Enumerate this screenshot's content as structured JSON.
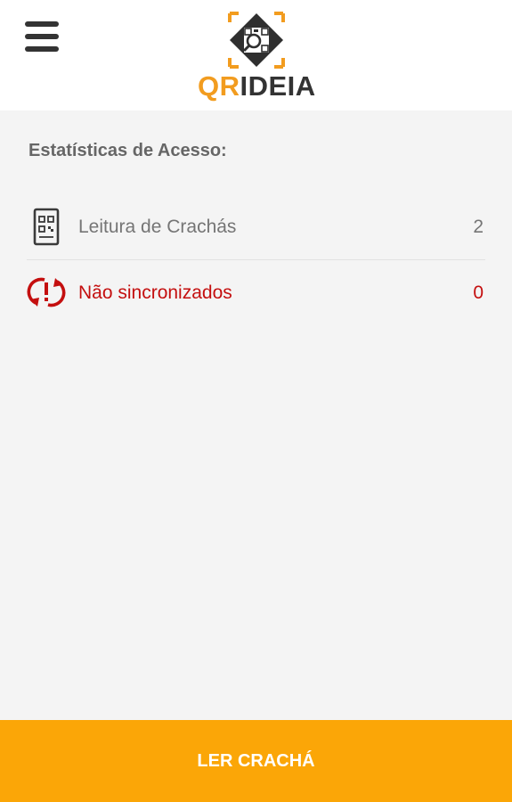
{
  "header": {
    "menu_icon": "hamburger-menu-icon",
    "logo": {
      "text_part1": "QR",
      "text_part2": "IDEIA",
      "mark_icon": "qr-search-diamond-icon"
    }
  },
  "main": {
    "section_title": "Estatísticas de Acesso:",
    "stats": [
      {
        "label": "Leitura de Crachás",
        "value": "2",
        "icon": "badge-qr-scan-icon",
        "color": "#757575"
      },
      {
        "label": "Não sincronizados",
        "value": "0",
        "icon": "sync-warning-icon",
        "color": "#c40f0f"
      }
    ]
  },
  "footer": {
    "button_label": "LER CRACHÁ",
    "button_color": "#fba607"
  },
  "colors": {
    "brand_orange": "#f29c1f",
    "dark": "#333333",
    "background": "#f4f4f4",
    "alert_red": "#c40f0f"
  }
}
